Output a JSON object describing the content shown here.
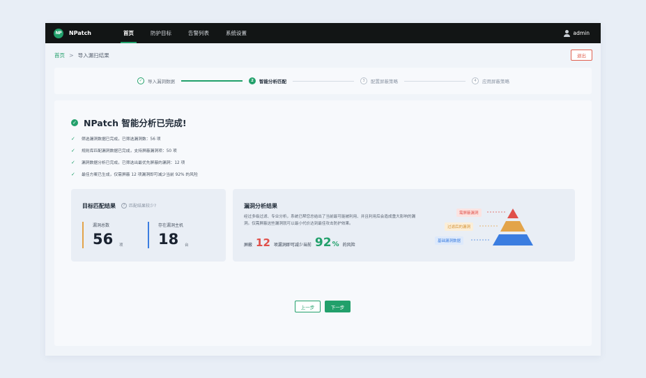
{
  "brand": {
    "logo_mark": "NP",
    "name": "NPatch"
  },
  "nav": {
    "items": [
      {
        "label": "首页",
        "active": true
      },
      {
        "label": "防护目标",
        "active": false
      },
      {
        "label": "告警列表",
        "active": false
      },
      {
        "label": "系统设置",
        "active": false
      }
    ],
    "user": "admin"
  },
  "breadcrumb": {
    "home": "首页",
    "separator": ">",
    "current": "导入漏扫结果"
  },
  "logout_label": "退出",
  "steps": [
    {
      "num": "✓",
      "label": "导入漏洞数据",
      "state": "done"
    },
    {
      "num": "2",
      "label": "智能分析匹配",
      "state": "active"
    },
    {
      "num": "3",
      "label": "配置屏蔽策略",
      "state": "todo"
    },
    {
      "num": "4",
      "label": "应用屏蔽策略",
      "state": "todo"
    }
  ],
  "result": {
    "headline": "NPatch 智能分析已完成!",
    "checks": [
      "筛选漏洞数据已完成，已筛选漏洞数：56 项",
      "规则库匹配漏洞数据已完成，支持屏蔽漏洞项：50 项",
      "漏洞数据分析已完成，已筛选出最优先屏蔽的漏洞：12 项",
      "最佳方案已生成，仅需屏蔽 12 项漏洞即可减少当前 92% 的风险"
    ]
  },
  "match": {
    "title": "目标匹配结果",
    "help": "匹配结果较少?",
    "stats": [
      {
        "label": "漏洞总数",
        "value": "56",
        "unit": "项"
      },
      {
        "label": "存在漏洞主机",
        "value": "18",
        "unit": "台"
      }
    ]
  },
  "analysis": {
    "title": "漏洞分析结果",
    "description": "经过多级过滤、专业分析，系统已帮您总结出了当前最可能被利用、并且利用后会造成重大影响的漏洞。仅需屏蔽这些漏洞就可以最小代价达到最佳攻击防护效果。",
    "risk_prefix": "屏蔽",
    "risk_count": "12",
    "risk_middle": "项漏洞即可减少当前",
    "risk_percent": "92",
    "risk_percent_sign": "%",
    "risk_suffix": "的风险",
    "pyramid_tags": [
      "需屏蔽漏洞",
      "过滤后的漏洞",
      "基础漏洞数据"
    ]
  },
  "colors": {
    "accent": "#22a06b",
    "red": "#e0504a",
    "orange": "#e3a44a",
    "blue": "#3b7de0"
  },
  "buttons": {
    "prev": "上一步",
    "next": "下一步"
  }
}
